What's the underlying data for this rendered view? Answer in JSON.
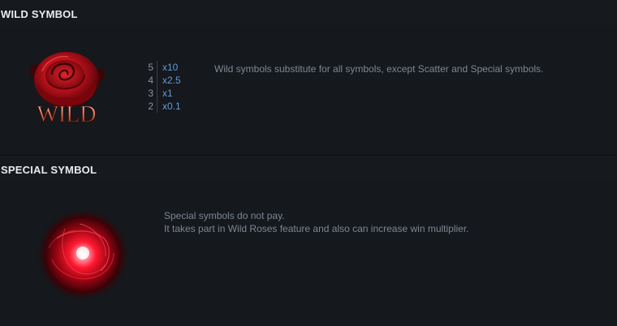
{
  "wild_section": {
    "title": "WILD SYMBOL",
    "symbol_text": "WILD",
    "symbol_icon": "red-rose-icon",
    "paytable": [
      {
        "count": "5",
        "multiplier": "x10"
      },
      {
        "count": "4",
        "multiplier": "x2.5"
      },
      {
        "count": "3",
        "multiplier": "x1"
      },
      {
        "count": "2",
        "multiplier": "x0.1"
      }
    ],
    "description": "Wild symbols substitute for all symbols, except Scatter and Special symbols."
  },
  "special_section": {
    "title": "SPECIAL SYMBOL",
    "symbol_icon": "glowing-red-orb-icon",
    "description_lines": [
      "Special symbols do not pay.",
      "It takes part in Wild Roses feature and also can increase win multiplier."
    ]
  },
  "colors": {
    "background": "#121418",
    "header_background": "#16191d",
    "title_text": "#e9ecef",
    "description_text": "#7c8796",
    "multiplier_text": "#5f9bd8",
    "count_text": "#8a929c",
    "rose_red": "#c0121c"
  }
}
